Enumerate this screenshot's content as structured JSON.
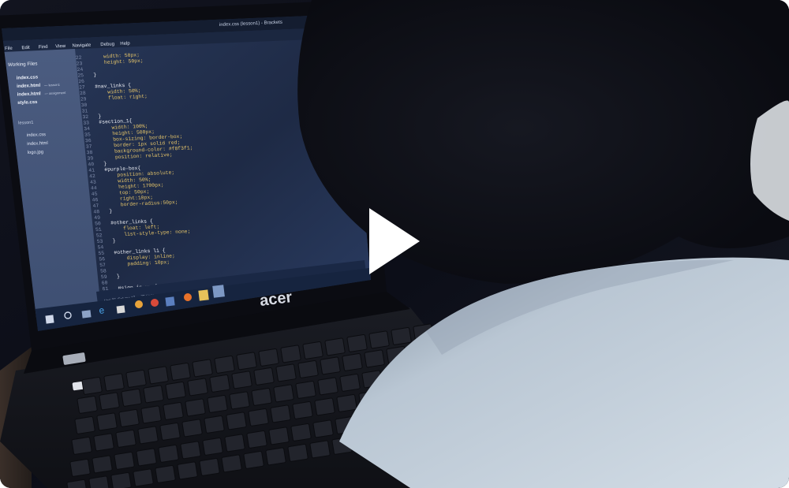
{
  "video": {
    "thumbnail_subject": "person-coding-on-laptop",
    "play_icon": "play-icon"
  },
  "screen": {
    "window_title": "index.css (lesson1) - Brackets",
    "menu_items": [
      "File",
      "Edit",
      "Find",
      "View",
      "Navigate",
      "Debug",
      "Help"
    ],
    "sidebar": {
      "working_files_label": "Working Files",
      "working_files": [
        {
          "name": "index.css",
          "suffix": ""
        },
        {
          "name": "index.html",
          "suffix": "— lesson1"
        },
        {
          "name": "index.html",
          "suffix": "— assignment"
        },
        {
          "name": "style.css",
          "suffix": ""
        }
      ],
      "project_label": "lesson1",
      "project_files": [
        "index.css",
        "index.html",
        "logo.jpg"
      ]
    },
    "code_lines": [
      {
        "n": "22",
        "text": "    width: 50px;"
      },
      {
        "n": "23",
        "text": "    height: 50px;"
      },
      {
        "n": "24",
        "text": ""
      },
      {
        "n": "25",
        "text": "}"
      },
      {
        "n": "26",
        "text": ""
      },
      {
        "n": "27",
        "text": "#nav_links {"
      },
      {
        "n": "28",
        "text": "    width: 50%;"
      },
      {
        "n": "29",
        "text": "    float: right;"
      },
      {
        "n": "30",
        "text": ""
      },
      {
        "n": "31",
        "text": ""
      },
      {
        "n": "32",
        "text": "}"
      },
      {
        "n": "33",
        "text": "#section_1{"
      },
      {
        "n": "34",
        "text": "    width: 100%;"
      },
      {
        "n": "35",
        "text": "    height: 500px;"
      },
      {
        "n": "36",
        "text": "    box-sizing: border-box;"
      },
      {
        "n": "37",
        "text": "    border: 1px solid red;"
      },
      {
        "n": "38",
        "text": "    background-color: #f8f3f1;"
      },
      {
        "n": "39",
        "text": "    position: relative;"
      },
      {
        "n": "40",
        "text": "}"
      },
      {
        "n": "41",
        "text": "#purple-box{"
      },
      {
        "n": "42",
        "text": "    position: absolute;"
      },
      {
        "n": "43",
        "text": "    width: 50%;"
      },
      {
        "n": "44",
        "text": "    height: 1700px;"
      },
      {
        "n": "45",
        "text": "    top: 50px;"
      },
      {
        "n": "46",
        "text": "    right:10px;"
      },
      {
        "n": "47",
        "text": "    border-radius:50px;"
      },
      {
        "n": "48",
        "text": "}"
      },
      {
        "n": "49",
        "text": ""
      },
      {
        "n": "50",
        "text": "#other_links {"
      },
      {
        "n": "51",
        "text": "    float: left;"
      },
      {
        "n": "52",
        "text": "    list-style-type: none;"
      },
      {
        "n": "53",
        "text": "}"
      },
      {
        "n": "54",
        "text": ""
      },
      {
        "n": "55",
        "text": "#other_links li {"
      },
      {
        "n": "56",
        "text": "    display: inline;"
      },
      {
        "n": "57",
        "text": "    padding: 10px;"
      },
      {
        "n": "58",
        "text": ""
      },
      {
        "n": "59",
        "text": "}"
      },
      {
        "n": "60",
        "text": ""
      },
      {
        "n": "61",
        "text": "#sign_in_up {"
      },
      {
        "n": "62",
        "text": "    float: right;"
      },
      {
        "n": "63",
        "text": "    list-style-type: none;"
      },
      {
        "n": "64",
        "text": "}"
      }
    ],
    "status_bar": "Line 37, Column 13 — 70 Lines"
  },
  "laptop": {
    "brand": "acer"
  },
  "colors": {
    "background_dark": "#0d0f1a",
    "screen_editor": "#22304a",
    "sidebar": "#3b4a6b",
    "taskbar": "#1a2a46",
    "shirt": "#c6d2de",
    "play_icon": "#ffffff"
  }
}
